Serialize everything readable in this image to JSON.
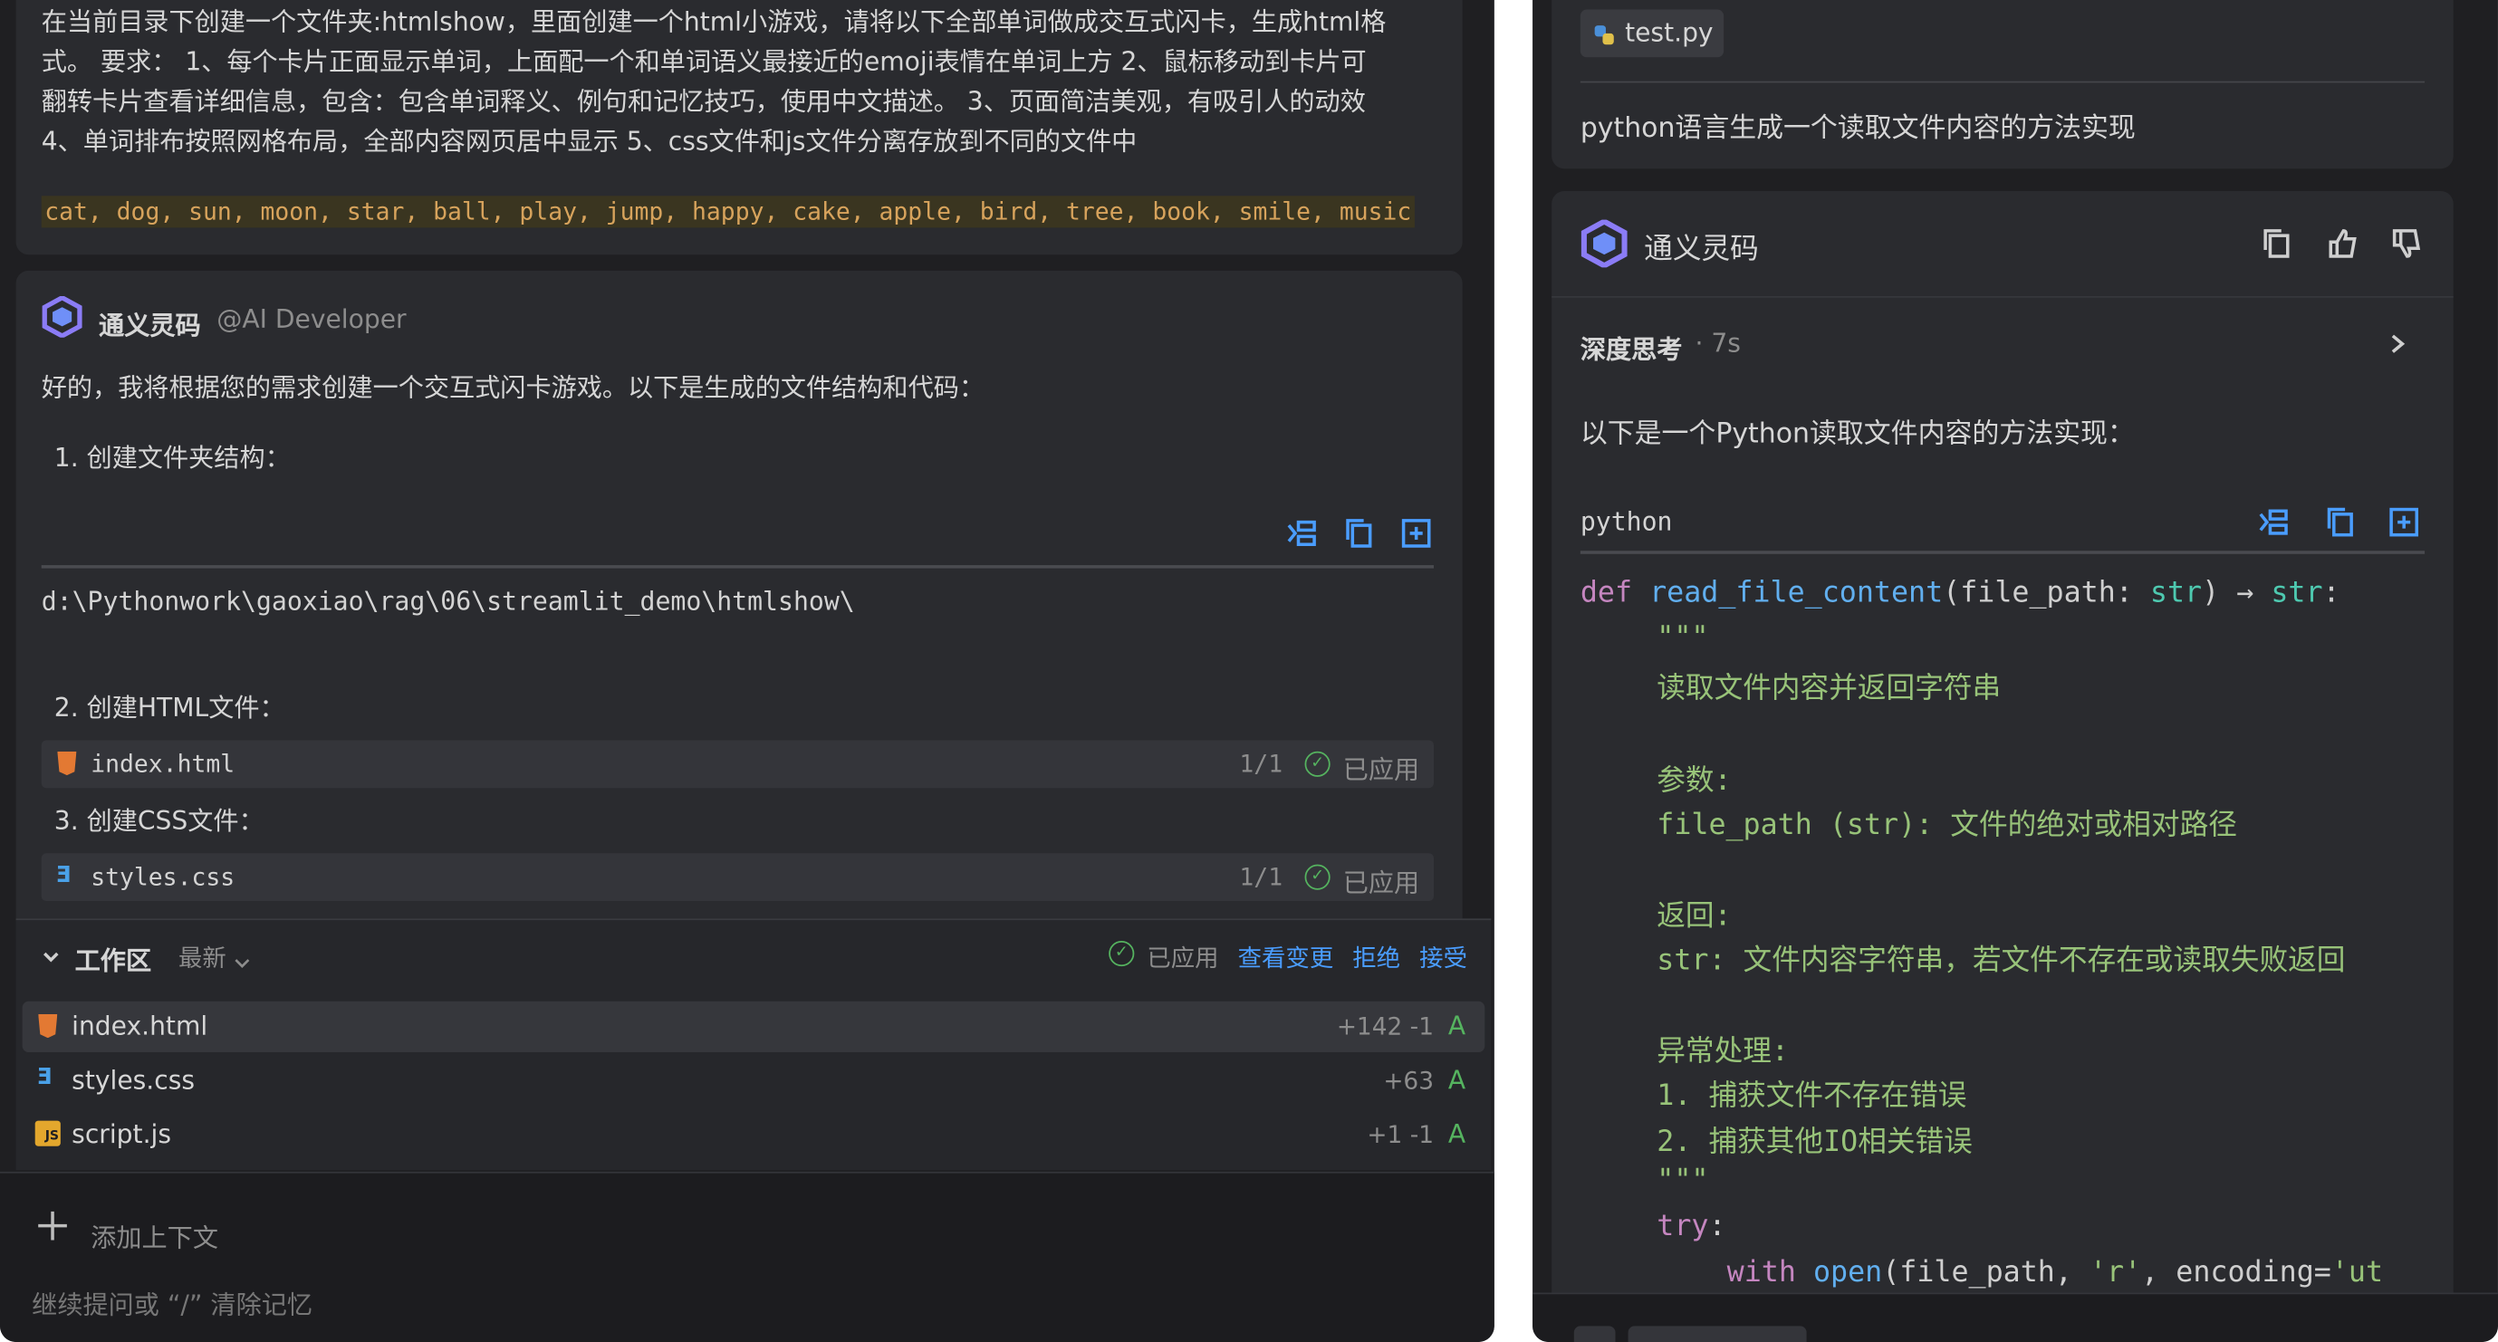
{
  "left": {
    "prompt": {
      "lines": [
        "在当前目录下创建一个文件夹:htmlshow，里面创建一个html小游戏，请将以下全部单词做成交互式闪卡，生成html格",
        "式。 要求： 1、每个卡片正面显示单词，上面配一个和单词语义最接近的emoji表情在单词上方 2、鼠标移动到卡片可",
        "翻转卡片查看详细信息，包含：包含单词释义、例句和记忆技巧，使用中文描述。 3、页面简洁美观，有吸引人的动效",
        "4、单词排布按照网格布局，全部内容网页居中显示 5、css文件和js文件分离存放到不同的文件中"
      ],
      "words": "cat, dog, sun, moon, star, ball, play, jump, happy, cake, apple, bird, tree, book, smile, music"
    },
    "reply": {
      "assistant_name": "通义灵码",
      "mention": "@AI Developer",
      "intro": "好的，我将根据您的需求创建一个交互式闪卡游戏。以下是生成的文件结构和代码：",
      "step1": "1. 创建文件夹结构：",
      "path": "d:\\Pythonwork\\gaoxiao\\rag\\06\\streamlit_demo\\htmlshow\\",
      "step2": "2. 创建HTML文件：",
      "file1": {
        "name": "index.html",
        "count": "1/1",
        "status": "已应用"
      },
      "step3": "3. 创建CSS文件：",
      "file2": {
        "name": "styles.css",
        "count": "1/1",
        "status": "已应用"
      }
    },
    "workspace": {
      "title": "工作区",
      "sort": "最新",
      "applied": "已应用",
      "view_changes": "查看变更",
      "reject": "拒绝",
      "accept": "接受",
      "files": [
        {
          "name": "index.html",
          "diff": "+142 -1",
          "flag": "A"
        },
        {
          "name": "styles.css",
          "diff": "+63",
          "flag": "A"
        },
        {
          "name": "script.js",
          "diff": "+1 -1",
          "flag": "A"
        }
      ]
    },
    "input": {
      "add_context": "添加上下文",
      "placeholder": "继续提问或 “/” 清除记忆"
    }
  },
  "right": {
    "file_tag": "test.py",
    "question": "python语言生成一个读取文件内容的方法实现",
    "assistant_name": "通义灵码",
    "thinking": "深度思考",
    "thinking_time": "· 7s",
    "intro": "以下是一个Python读取文件内容的方法实现：",
    "code_lang": "python",
    "code": {
      "def": "def",
      "fn": "read_file_content",
      "sig1": "(file_path: ",
      "type1": "str",
      "sig2": ") → ",
      "type2": "str",
      "sig3": ":",
      "doc_open": "\"\"\"",
      "doc1": "读取文件内容并返回字符串",
      "doc2": "参数:",
      "doc3": "file_path (str): 文件的绝对或相对路径",
      "doc4": "返回:",
      "doc5": "str: 文件内容字符串，若文件不存在或读取失败返回",
      "doc6": "异常处理:",
      "doc7": "1. 捕获文件不存在错误",
      "doc8": "2. 捕获其他IO相关错误",
      "doc_close": "\"\"\"",
      "try": "try",
      "colon": ":",
      "with": "with",
      "open": "open",
      "open_args": "(file_path, ",
      "mode": "'r'",
      "enc": ", encoding=",
      "enc_val": "'ut"
    }
  },
  "colors": {
    "bg": "#1f1f22",
    "card": "#2a2b2f",
    "link": "#4a9dff",
    "string": "#98c379",
    "keyword": "#c586c0",
    "function": "#61afef",
    "type": "#4ec9b0",
    "words_bg": "#3a3520",
    "words_fg": "#d7a35c"
  }
}
